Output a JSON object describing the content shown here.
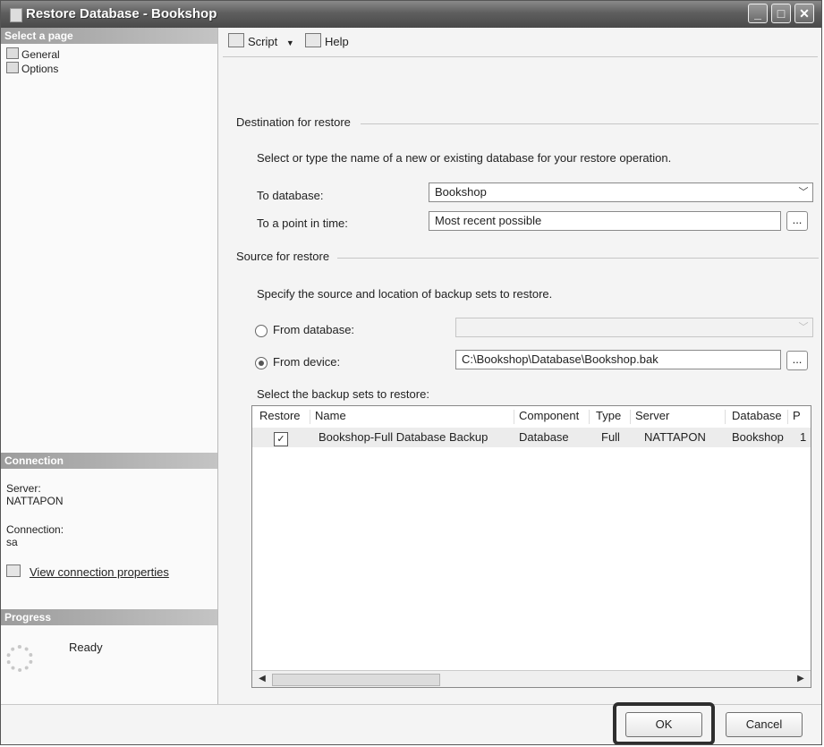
{
  "window": {
    "title": "Restore Database - Bookshop"
  },
  "left_panel": {
    "select_page_header": "Select a page",
    "pages": [
      {
        "label": "General"
      },
      {
        "label": "Options"
      }
    ],
    "connection_header": "Connection",
    "server_label": "Server:",
    "server_value": "NATTAPON",
    "connection_label": "Connection:",
    "connection_value": "sa",
    "view_connection_link": "View connection properties",
    "progress_header": "Progress",
    "progress_status": "Ready"
  },
  "toolbar": {
    "script_label": "Script",
    "help_label": "Help"
  },
  "destination": {
    "section_title": "Destination for restore",
    "description": "Select or type the name of a new or existing database for your restore operation.",
    "to_database_label": "To database:",
    "to_database_value": "Bookshop",
    "point_in_time_label": "To a point in time:",
    "point_in_time_value": "Most recent possible",
    "browse_label": "..."
  },
  "source": {
    "section_title": "Source for restore",
    "description": "Specify the source and location of backup sets to restore.",
    "from_database_label": "From database:",
    "from_database_value": "",
    "from_device_label": "From device:",
    "from_device_value": "C:\\Bookshop\\Database\\Bookshop.bak",
    "browse_label": "...",
    "selected_option": "From device"
  },
  "backup_sets": {
    "label": "Select the backup sets to restore:",
    "columns": [
      "Restore",
      "Name",
      "Component",
      "Type",
      "Server",
      "Database",
      "P"
    ],
    "rows": [
      {
        "restore": "✓",
        "name": "Bookshop-Full Database Backup",
        "component": "Database",
        "type": "Full",
        "server": "NATTAPON",
        "database": "Bookshop",
        "p": "1"
      }
    ]
  },
  "buttons": {
    "ok_label": "OK",
    "cancel_label": "Cancel"
  }
}
